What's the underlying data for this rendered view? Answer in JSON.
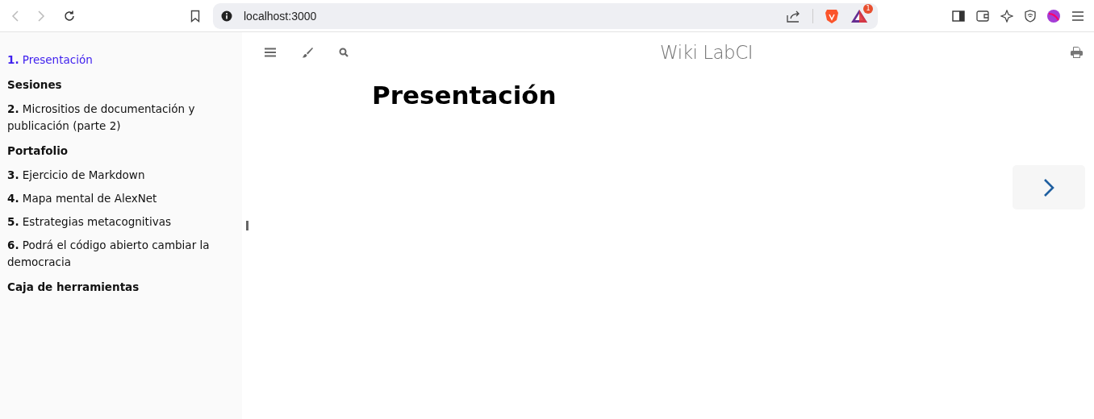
{
  "browser": {
    "address": "localhost:3000",
    "rewards_badge": "1"
  },
  "sidebar": {
    "items": [
      {
        "kind": "chapter",
        "number": "1.",
        "title": "Presentación",
        "selected": true
      },
      {
        "kind": "part",
        "title": "Sesiones"
      },
      {
        "kind": "chapter",
        "number": "2.",
        "title": "Micrositios de documentación y publicación (parte 2)",
        "selected": false
      },
      {
        "kind": "part",
        "title": "Portafolio"
      },
      {
        "kind": "chapter",
        "number": "3.",
        "title": "Ejercicio de Markdown",
        "selected": false
      },
      {
        "kind": "chapter",
        "number": "4.",
        "title": "Mapa mental de AlexNet",
        "selected": false
      },
      {
        "kind": "chapter",
        "number": "5.",
        "title": "Estrategias metacognitivas",
        "selected": false
      },
      {
        "kind": "chapter",
        "number": "6.",
        "title": "Podrá el código abierto cambiar la democracia",
        "selected": false
      },
      {
        "kind": "part",
        "title": "Caja de herramientas"
      }
    ]
  },
  "menu_bar": {
    "title": "Wiki LabCI"
  },
  "content": {
    "heading": "Presentación"
  }
}
